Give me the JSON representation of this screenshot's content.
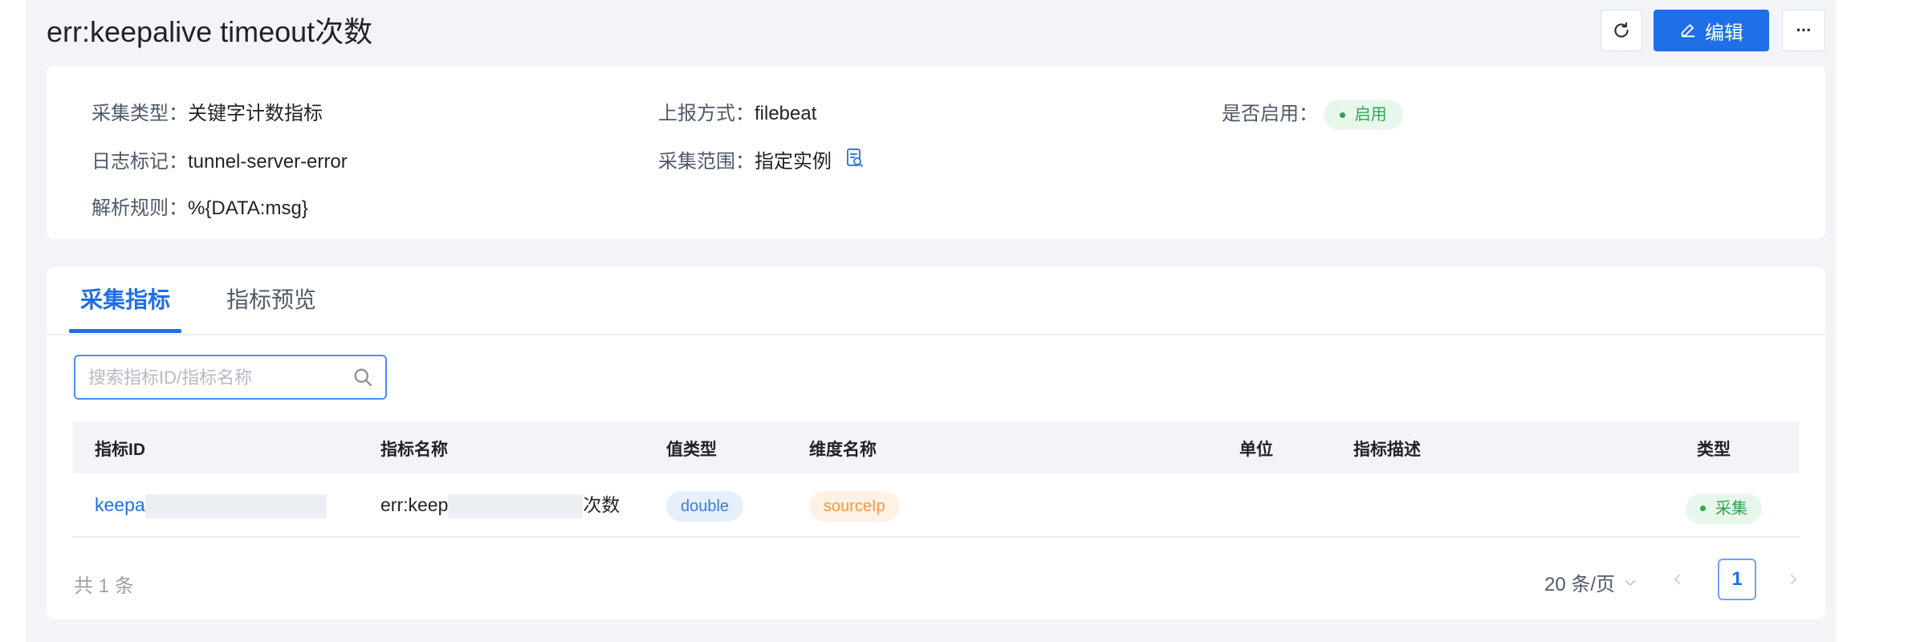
{
  "header": {
    "title": "err:keepalive timeout次数",
    "edit_label": "编辑",
    "more_label": "···"
  },
  "info": {
    "collect_type_label": "采集类型：",
    "collect_type_value": "关键字计数指标",
    "report_method_label": "上报方式：",
    "report_method_value": "filebeat",
    "enabled_label": "是否启用：",
    "enabled_value": "启用",
    "log_tag_label": "日志标记：",
    "log_tag_value": "tunnel-server-error",
    "scope_label": "采集范围：",
    "scope_value": "指定实例",
    "parse_rule_label": "解析规则：",
    "parse_rule_value": "%{DATA:msg}"
  },
  "tabs": [
    {
      "label": "采集指标",
      "active": true
    },
    {
      "label": "指标预览",
      "active": false
    }
  ],
  "search": {
    "placeholder": "搜索指标ID/指标名称",
    "value": ""
  },
  "table": {
    "columns": [
      "指标ID",
      "指标名称",
      "值类型",
      "维度名称",
      "单位",
      "指标描述",
      "类型"
    ],
    "rows": [
      {
        "metric_id": "keepa",
        "metric_name_prefix": "err:keep",
        "metric_name_suffix": "次数",
        "value_type": "double",
        "dimension": "sourceIp",
        "unit": "",
        "description": "",
        "type": "采集"
      }
    ]
  },
  "pagination": {
    "total_prefix": "共",
    "total_count": "1",
    "total_suffix": "条",
    "page_size": "20 条/页",
    "current_page": "1"
  },
  "colors": {
    "primary": "#1f6fe6",
    "success": "#2fa44f",
    "warning": "#f59a3d"
  }
}
